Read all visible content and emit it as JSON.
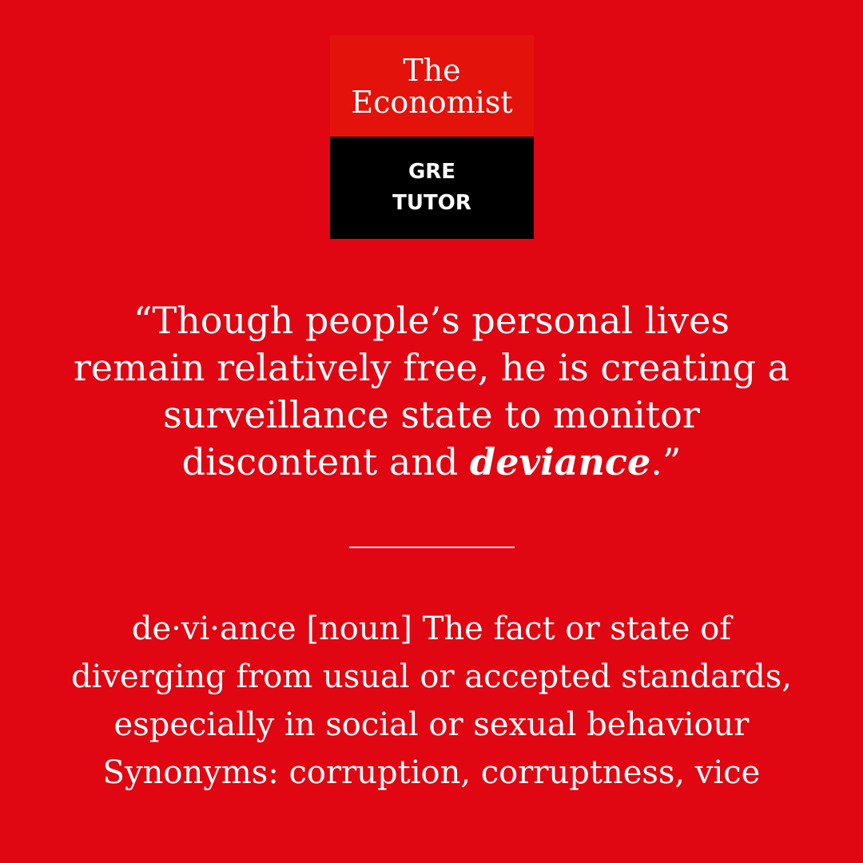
{
  "colors": {
    "background": "#e00612",
    "logo_red": "#e3120b",
    "logo_black": "#000000",
    "text": "#ffffff"
  },
  "logo": {
    "brand_line1": "The",
    "brand_line2": "Economist",
    "product_line1": "GRE",
    "product_line2": "TUTOR"
  },
  "quote": {
    "line1": "“Though people’s personal lives",
    "line2": "remain relatively free, he is creating a",
    "line3": "surveillance state to monitor",
    "line4_prefix": "discontent and ",
    "highlight_word": "deviance",
    "line4_suffix": ".”"
  },
  "definition": {
    "line1": "de·vi·ance [noun] The fact or state of",
    "line2": "diverging from usual or accepted standards,",
    "line3": "especially in social or sexual behaviour",
    "synonyms_line": "Synonyms: corruption, corruptness, vice"
  }
}
